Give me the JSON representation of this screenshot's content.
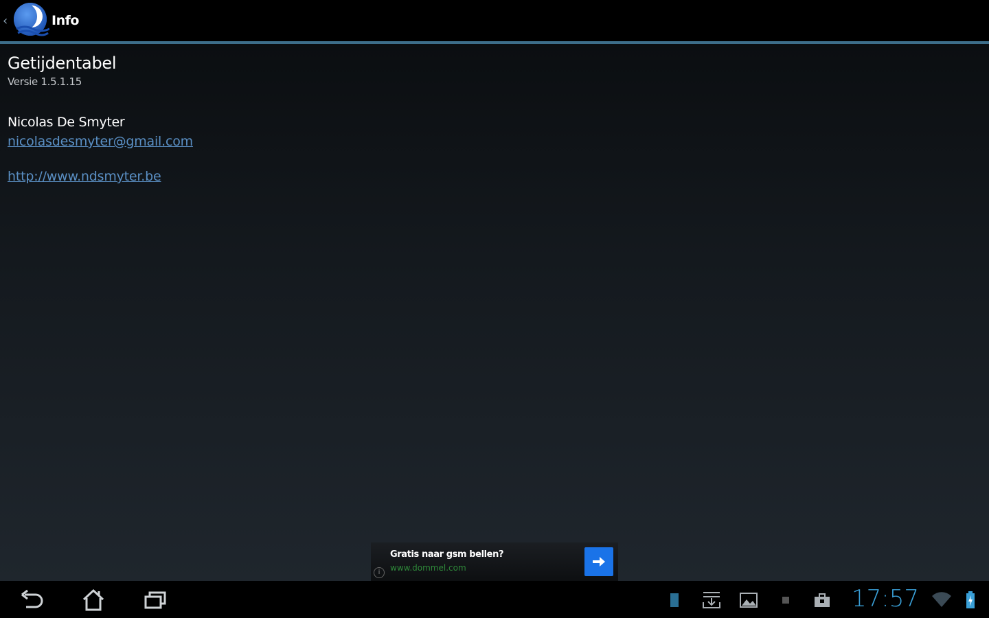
{
  "action_bar": {
    "title": "Info",
    "up_caret": "‹"
  },
  "about": {
    "app_name": "Getijdentabel",
    "version": "Versie 1.5.1.15",
    "author": "Nicolas De Smyter",
    "email": "nicolasdesmyter@gmail.com",
    "website": "http://www.ndsmyter.be"
  },
  "ad": {
    "headline": "Gratis naar gsm bellen?",
    "url": "www.dommel.com",
    "info_glyph": "i"
  },
  "system_bar": {
    "clock": "17:57"
  },
  "colors": {
    "accent": "#3d6e8a",
    "link": "#5a8fc4",
    "clock": "#3aa0d8",
    "ad_button": "#1a73e8"
  }
}
